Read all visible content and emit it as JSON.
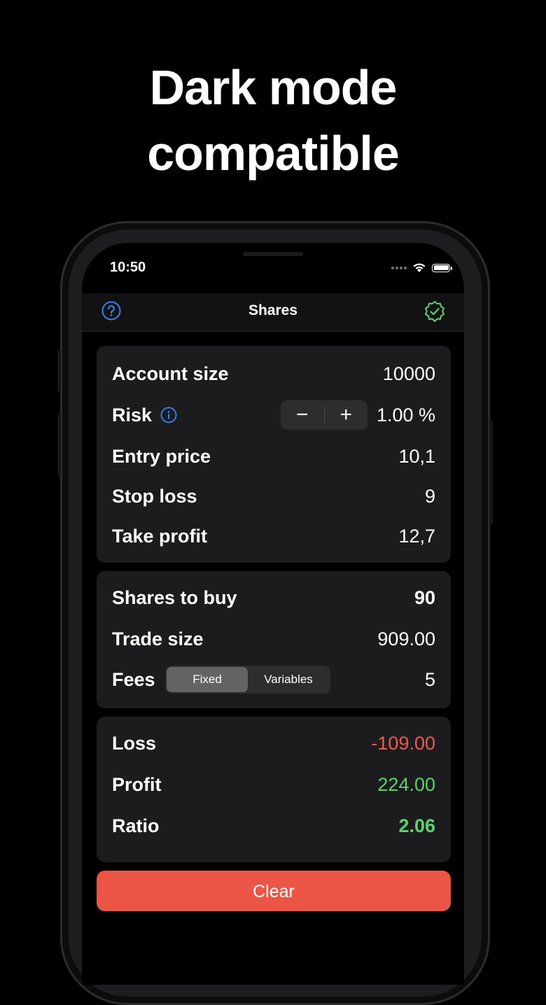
{
  "headline": {
    "line1": "Dark mode",
    "line2": "compatible"
  },
  "status_bar": {
    "time": "10:50"
  },
  "nav": {
    "title": "Shares"
  },
  "inputs": {
    "account_size": {
      "label": "Account size",
      "value": "10000"
    },
    "risk": {
      "label": "Risk",
      "value": "1.00 %",
      "minus": "−",
      "plus": "+"
    },
    "entry_price": {
      "label": "Entry price",
      "value": "10,1"
    },
    "stop_loss": {
      "label": "Stop loss",
      "value": "9"
    },
    "take_profit": {
      "label": "Take profit",
      "value": "12,7"
    }
  },
  "trade": {
    "shares_to_buy": {
      "label": "Shares to buy",
      "value": "90"
    },
    "trade_size": {
      "label": "Trade size",
      "value": "909.00"
    },
    "fees": {
      "label": "Fees",
      "value": "5",
      "options": [
        "Fixed",
        "Variables"
      ],
      "selected": "Fixed"
    }
  },
  "results": {
    "loss": {
      "label": "Loss",
      "value": "-109.00"
    },
    "profit": {
      "label": "Profit",
      "value": "224.00"
    },
    "ratio": {
      "label": "Ratio",
      "value": "2.06"
    }
  },
  "clear_label": "Clear",
  "colors": {
    "loss": "#eb5a4f",
    "profit": "#5dd26a",
    "accent": "#3a82f7",
    "clear": "#eb5545"
  }
}
